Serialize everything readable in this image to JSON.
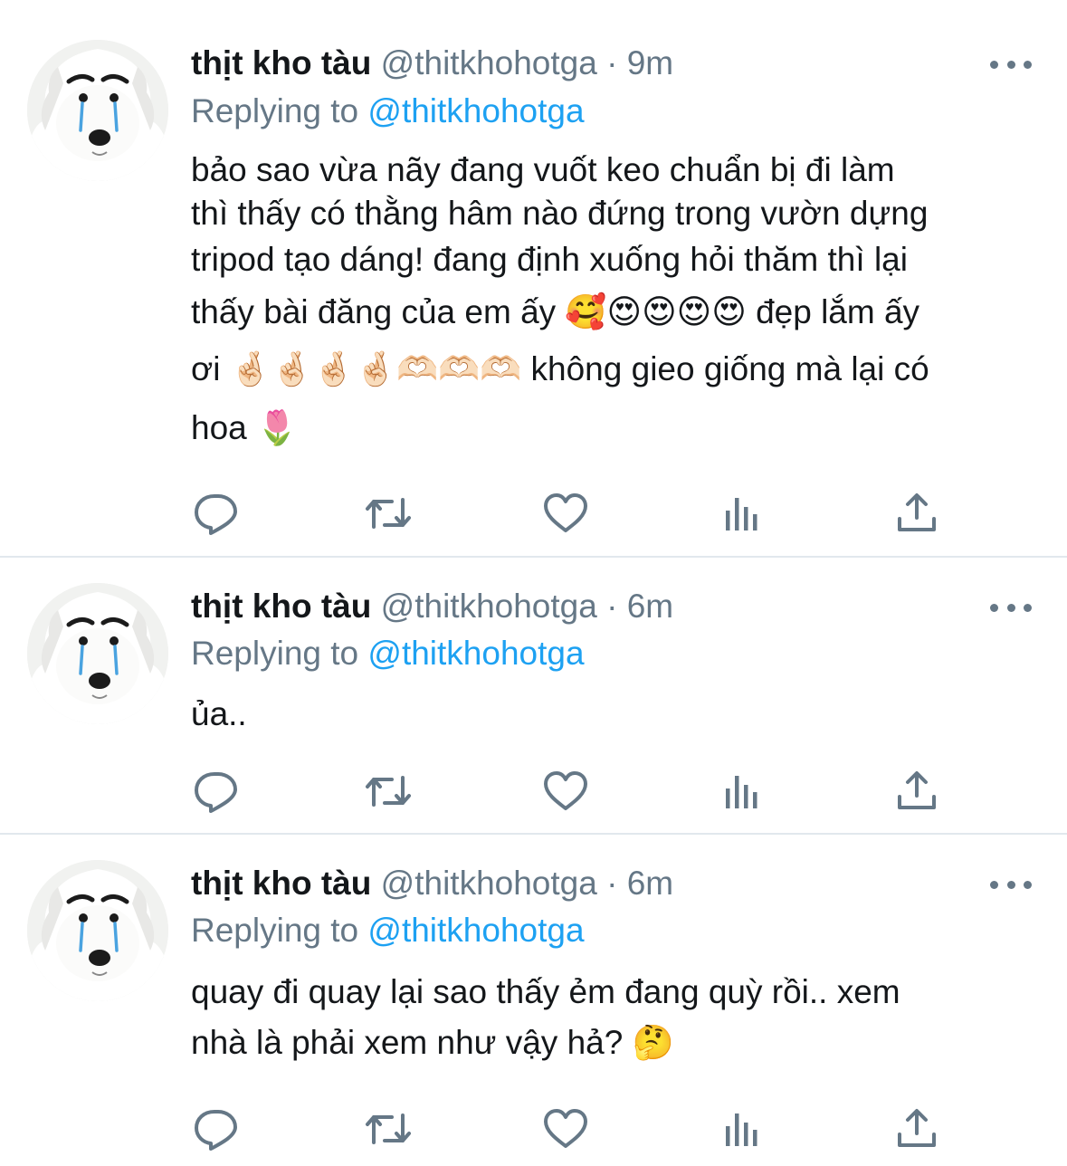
{
  "colors": {
    "accent": "#1da1f2",
    "secondary": "#657786",
    "text": "#14171a",
    "divider": "#e1e8ed"
  },
  "action_icons": [
    "reply-icon",
    "retweet-icon",
    "like-icon",
    "analytics-icon",
    "share-icon"
  ],
  "tweets": [
    {
      "name": "thịt kho tàu",
      "handle": "@thitkhohotga",
      "dot": "·",
      "time": "9m",
      "reply_prefix": "Replying to",
      "reply_mention": "@thitkhohotga",
      "lines": [
        "bảo sao vừa nãy đang vuốt keo chuẩn bị đi làm",
        "thì thấy có thằng hâm nào đứng trong vườn dựng",
        "tripod tạo dáng! đang định xuống hỏi thăm thì lại",
        "thấy bài đăng của em ấy 🥰😍😍😍😍  đẹp lắm ấy",
        "ơi 🤞🏻🤞🏻🤞🏻🤞🏻🫶🏻🫶🏻🫶🏻 không gieo giống mà lại có",
        "hoa 🌷"
      ]
    },
    {
      "name": "thịt kho tàu",
      "handle": "@thitkhohotga",
      "dot": "·",
      "time": "6m",
      "reply_prefix": "Replying to",
      "reply_mention": "@thitkhohotga",
      "lines": [
        "ủa.."
      ]
    },
    {
      "name": "thịt kho tàu",
      "handle": "@thitkhohotga",
      "dot": "·",
      "time": "6m",
      "reply_prefix": "Replying to",
      "reply_mention": "@thitkhohotga",
      "lines": [
        "quay đi quay lại sao thấy ẻm đang quỳ rồi.. xem",
        "nhà là phải xem như vậy hả? 🤔"
      ]
    }
  ]
}
